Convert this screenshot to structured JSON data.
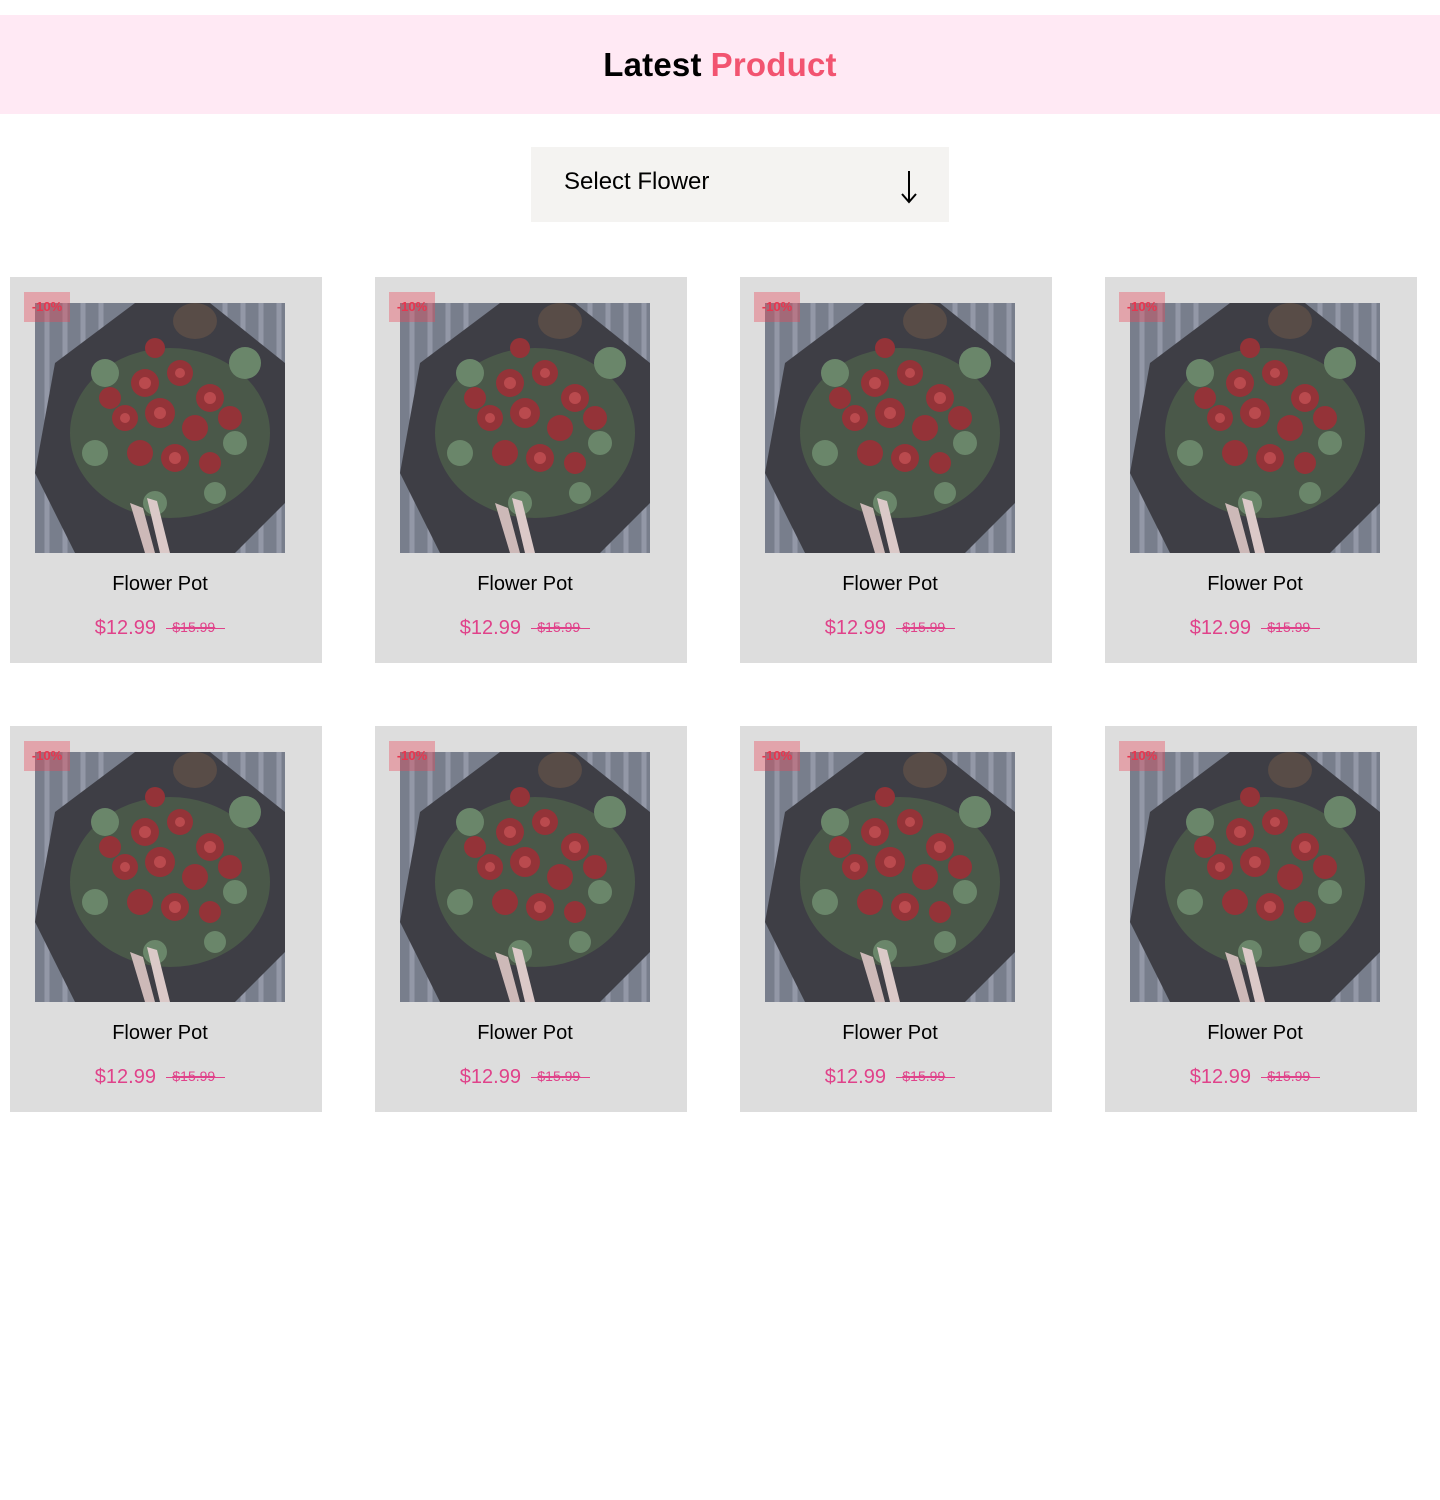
{
  "colors": {
    "banner_bg": "#ffe9f4",
    "accent": "#f25470",
    "price": "#e0428a",
    "card_bg": "#dddddd",
    "select_bg": "#f4f3f1"
  },
  "header": {
    "title_main": "Latest",
    "title_accent": "Product"
  },
  "filter": {
    "label": "Select Flower",
    "icon": "arrow-down-icon"
  },
  "products": [
    {
      "badge": "-10%",
      "name": "Flower Pot",
      "price": "$12.99",
      "old_price": "$15.99",
      "image": "red-rose-bouquet"
    },
    {
      "badge": "-10%",
      "name": "Flower Pot",
      "price": "$12.99",
      "old_price": "$15.99",
      "image": "red-rose-bouquet"
    },
    {
      "badge": "-10%",
      "name": "Flower Pot",
      "price": "$12.99",
      "old_price": "$15.99",
      "image": "red-rose-bouquet"
    },
    {
      "badge": "-10%",
      "name": "Flower Pot",
      "price": "$12.99",
      "old_price": "$15.99",
      "image": "red-rose-bouquet"
    },
    {
      "badge": "-10%",
      "name": "Flower Pot",
      "price": "$12.99",
      "old_price": "$15.99",
      "image": "red-rose-bouquet"
    },
    {
      "badge": "-10%",
      "name": "Flower Pot",
      "price": "$12.99",
      "old_price": "$15.99",
      "image": "red-rose-bouquet"
    },
    {
      "badge": "-10%",
      "name": "Flower Pot",
      "price": "$12.99",
      "old_price": "$15.99",
      "image": "red-rose-bouquet"
    },
    {
      "badge": "-10%",
      "name": "Flower Pot",
      "price": "$12.99",
      "old_price": "$15.99",
      "image": "red-rose-bouquet"
    }
  ]
}
